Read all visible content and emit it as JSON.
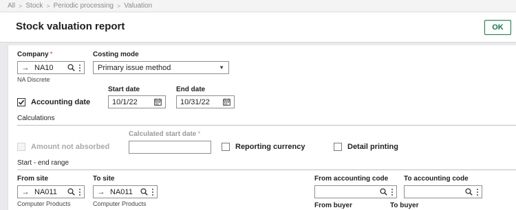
{
  "breadcrumb": [
    "All",
    "Stock",
    "Periodic processing",
    "Valuation"
  ],
  "breadcrumb_separator": ">",
  "header": {
    "title": "Stock valuation report",
    "ok_label": "OK"
  },
  "company": {
    "label": "Company",
    "required_mark": "*",
    "value": "NA10",
    "description": "NA Discrete"
  },
  "costing_mode": {
    "label": "Costing mode",
    "value": "Primary issue method"
  },
  "accounting_date": {
    "label": "Accounting date",
    "checked": true
  },
  "start_date": {
    "label": "Start date",
    "value": "10/1/22"
  },
  "end_date": {
    "label": "End date",
    "value": "10/31/22"
  },
  "calculations": {
    "title": "Calculations",
    "amount_not_absorbed": {
      "label": "Amount not absorbed",
      "checked": false,
      "disabled": true
    },
    "calculated_start_date": {
      "label": "Calculated start date",
      "required_mark": "*",
      "value": ""
    },
    "reporting_currency": {
      "label": "Reporting currency",
      "checked": false
    },
    "detail_printing": {
      "label": "Detail printing",
      "checked": false
    }
  },
  "range": {
    "title": "Start - end range",
    "from_site": {
      "label": "From site",
      "value": "NA011",
      "description": "Computer Products"
    },
    "to_site": {
      "label": "To site",
      "value": "NA011",
      "description": "Computer Products"
    },
    "from_accounting_code": {
      "label": "From accounting code",
      "value": ""
    },
    "to_accounting_code": {
      "label": "To accounting code",
      "value": ""
    },
    "from_buyer": {
      "label": "From buyer"
    },
    "to_buyer": {
      "label": "To buyer"
    }
  },
  "icons": {
    "arrow": "arrow-right-icon",
    "search": "search-icon",
    "more": "kebab-menu-icon",
    "calendar": "calendar-icon",
    "dropdown": "caret-down-icon",
    "check": "checkmark-icon"
  },
  "colors": {
    "accent": "#0a7c3e",
    "required": "#d64541",
    "background": "#e9eaec"
  }
}
